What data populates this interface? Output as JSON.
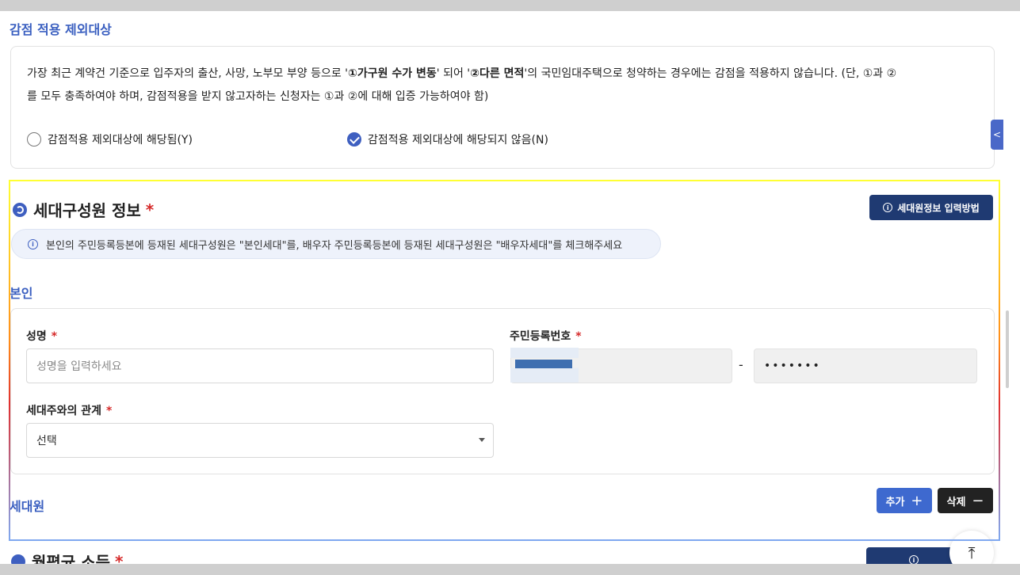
{
  "exclusion": {
    "title": "감점 적용 제외대상",
    "notice_line1_a": "가장 최근 계약건 기준으로 입주자의 출산, 사망, 노부모 부양 등으로 '",
    "notice_bold1": "①가구원 수가 변동",
    "notice_line1_b": "' 되어 '",
    "notice_bold2": "②다른 면적",
    "notice_line1_c": "'의 국민임대주택으로 청약하는 경우에는 감점을 적용하지 않습니다. (단, ①과 ②",
    "notice_line2": "를 모두 충족하여야 하며, 감점적용을 받지 않고자하는 신청자는 ①과 ②에 대해 입증 가능하여야 함)",
    "option_yes": "감점적용 제외대상에 해당됨(Y)",
    "option_no": "감점적용 제외대상에 해당되지 않음(N)",
    "selected": "N"
  },
  "household": {
    "title": "세대구성원 정보",
    "required_mark": "*",
    "help_button": "세대원정보 입력방법",
    "info": "본인의 주민등록등본에 등재된 세대구성원은 \"본인세대\"를, 배우자 주민등록등본에 등재된 세대구성원은 \"배우자세대\"를 체크해주세요",
    "self_title": "본인",
    "name_label": "성명",
    "name_placeholder": "성명을 입력하세요",
    "rrn_label": "주민등록번호",
    "rrn_back": "•••••••",
    "rrn_sep": "-",
    "relation_label": "세대주와의 관계",
    "relation_value": "선택",
    "members_title": "세대원",
    "add_button": "추가",
    "delete_button": "삭제"
  },
  "next_section": {
    "title": "월평균 소득",
    "required_mark": "*"
  },
  "side_tab": "<",
  "scroll_top": "⤒",
  "colors": {
    "accent": "#3e5fc0",
    "navy": "#1f3a72",
    "required": "#d62b2b"
  }
}
